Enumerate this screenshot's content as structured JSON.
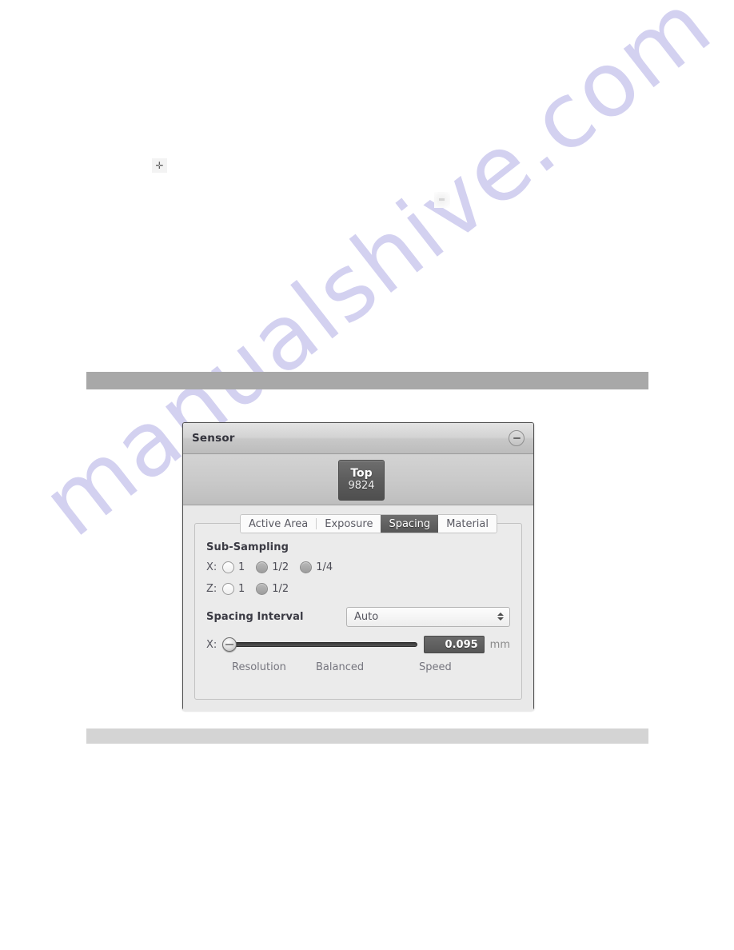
{
  "page": {
    "watermark": "manualshive.com",
    "artifacts": {
      "plus_glyph": "✛",
      "smudge_name": "faint-scan-smudge"
    }
  },
  "rules": {
    "top_color": "#a8a8a8",
    "bottom_color": "#d4d4d4"
  },
  "panel": {
    "title": "Sensor",
    "minimize_icon": "minus-icon",
    "sensor_tile": {
      "name": "Top",
      "value": "9824"
    },
    "tabs": [
      {
        "label": "Active Area",
        "active": false
      },
      {
        "label": "Exposure",
        "active": false
      },
      {
        "label": "Spacing",
        "active": true
      },
      {
        "label": "Material",
        "active": false
      }
    ],
    "sub_sampling": {
      "heading": "Sub-Sampling",
      "rows": [
        {
          "axis": "X:",
          "options": [
            {
              "label": "1",
              "selected": true
            },
            {
              "label": "1/2",
              "selected": false
            },
            {
              "label": "1/4",
              "selected": false
            }
          ]
        },
        {
          "axis": "Z:",
          "options": [
            {
              "label": "1",
              "selected": true
            },
            {
              "label": "1/2",
              "selected": false
            }
          ]
        }
      ]
    },
    "spacing_interval": {
      "heading": "Spacing Interval",
      "mode": "Auto",
      "axis": "X:",
      "value": "0.095",
      "unit": "mm",
      "slider_position_pct": 0,
      "scale": {
        "left": "Resolution",
        "middle": "Balanced",
        "right": "Speed"
      }
    }
  },
  "colors": {
    "panel_background": "#e9e9e9",
    "active_tab_background": "#5f5f5f",
    "sensor_tile_background": "#5c5c5c",
    "value_box_background": "#5f5f5f",
    "watermark": "#b9b6e8"
  }
}
